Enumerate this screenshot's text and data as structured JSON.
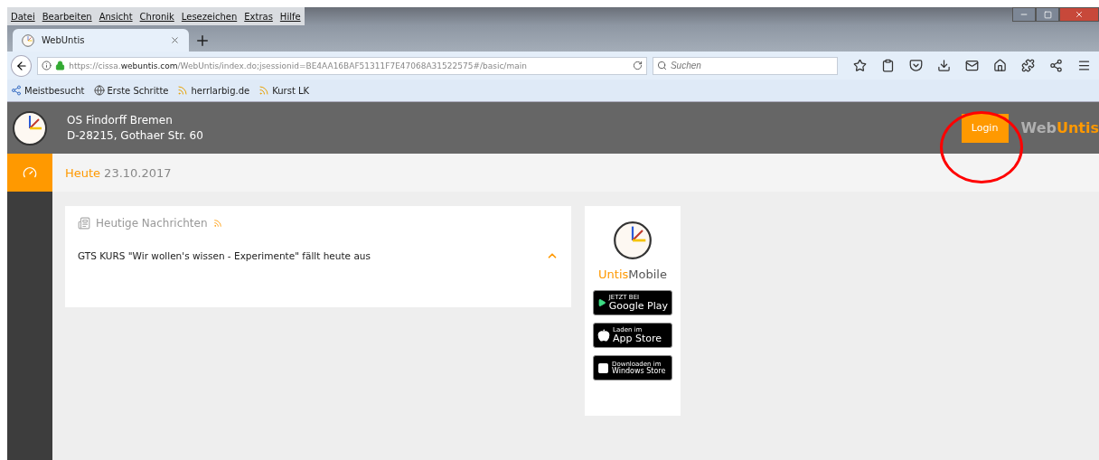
{
  "menu_bar": [
    "Datei",
    "Bearbeiten",
    "Ansicht",
    "Chronik",
    "Lesezeichen",
    "Extras",
    "Hilfe"
  ],
  "tabs": [
    {
      "label": "WebUntis",
      "selected": true
    }
  ],
  "address_bar": {
    "url_prefix": "https://cissa.",
    "url_domain": "webuntis.com",
    "url_rest": "/WebUntis/index.do;jsessionid=BE4AA16BAF51311F7E47068A31522575#/basic/main"
  },
  "search": {
    "placeholder": "Suchen"
  },
  "bookmarks": [
    {
      "label": "Meistbesucht",
      "kind": "smart"
    },
    {
      "label": "Erste Schritte",
      "kind": "globe"
    },
    {
      "label": "herrlarbig.de",
      "kind": "feed"
    },
    {
      "label": "Kurst LK",
      "kind": "feed"
    }
  ],
  "header": {
    "school_name": "OS Findorff Bremen",
    "school_address": "D-28215, Gothaer Str. 60",
    "login_button": "Login",
    "brand_first": "Web",
    "brand_second": "Untis"
  },
  "sidebar": {
    "items": [
      {
        "kind": "home",
        "selected": true
      }
    ]
  },
  "page_title": {
    "label": "Heute",
    "date": "23.10.2017"
  },
  "news": {
    "title": "Heutige Nachrichten",
    "items": [
      {
        "text": "GTS KURS \"Wir wollen's wissen - Experimente\" fällt heute aus",
        "expanded": true
      }
    ]
  },
  "mobile": {
    "brand_first": "Untis",
    "brand_second": "Mobile",
    "stores": [
      {
        "kind": "google",
        "small": "JETZT BEI",
        "big": "Google Play"
      },
      {
        "kind": "apple",
        "small": "Laden im",
        "big": "App Store"
      },
      {
        "kind": "windows",
        "small": "Downloaden im",
        "big": "Windows Store"
      }
    ]
  },
  "annotation": {
    "kind": "circle"
  }
}
